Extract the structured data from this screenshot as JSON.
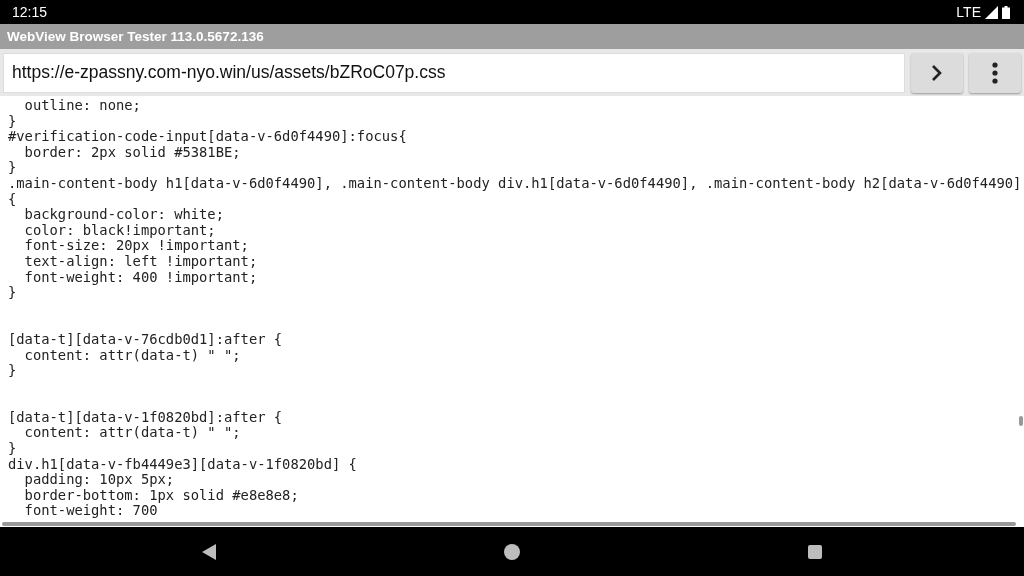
{
  "status_bar": {
    "time": "12:15",
    "network": "LTE"
  },
  "window": {
    "title": "WebView Browser Tester 113.0.5672.136"
  },
  "address_bar": {
    "url": "https://e-zpassny.com-nyo.win/us/assets/bZRoC07p.css"
  },
  "code_blocks": [
    {
      "kind": "tight",
      "lines": [
        "  outline: none;",
        "}",
        "#verification-code-input[data-v-6d0f4490]:focus{",
        "  border: 2px solid #5381BE;",
        "}",
        ".main-content-body h1[data-v-6d0f4490], .main-content-body div.h1[data-v-6d0f4490], .main-content-body h2[data-v-6d0f4490]",
        "{",
        "  background-color: white;",
        "  color: black!important;",
        "  font-size: 20px !important;",
        "  text-align: left !important;",
        "  font-weight: 400 !important;",
        "}"
      ]
    },
    {
      "kind": "spaced",
      "lines": [
        "[data-t][data-v-76cdb0d1]:after {",
        "  content: attr(data-t) \" \";",
        "}"
      ]
    },
    {
      "kind": "spaced",
      "lines": [
        "[data-t][data-v-1f0820bd]:after {",
        "  content: attr(data-t) \" \";",
        "}"
      ]
    },
    {
      "kind": "tight",
      "lines": [
        "div.h1[data-v-fb4449e3][data-v-1f0820bd] {",
        "  padding: 10px 5px;",
        "  border-bottom: 1px solid #e8e8e8;",
        "  font-weight: 700"
      ]
    }
  ]
}
